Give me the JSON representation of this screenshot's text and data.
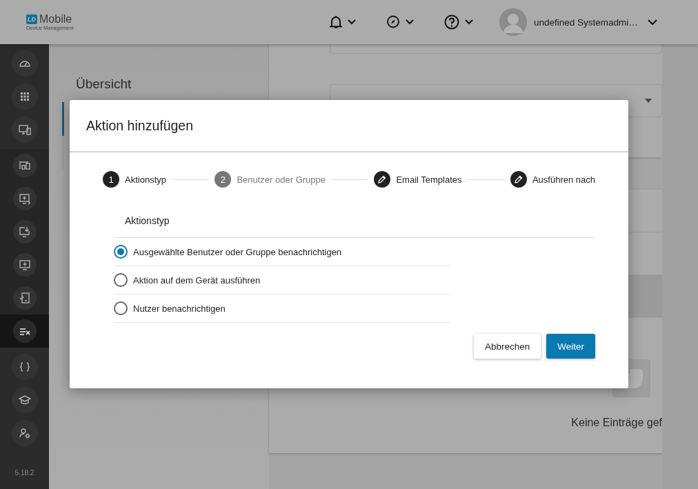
{
  "header": {
    "logo": {
      "mark": "LD",
      "title": "Mobile",
      "subtitle": "Device Management"
    },
    "user_name": "undefined Systemadmi…"
  },
  "sidebar": {
    "groups": [
      {
        "items": [
          {
            "selected": false
          },
          {
            "selected": false
          },
          {
            "selected": false
          }
        ]
      },
      {
        "items": [
          {
            "selected": false
          },
          {
            "selected": false
          },
          {
            "selected": false
          },
          {
            "selected": false
          },
          {
            "selected": false
          },
          {
            "selected": true
          }
        ]
      },
      {
        "items": [
          {
            "selected": false
          },
          {
            "selected": false
          },
          {
            "selected": false
          }
        ]
      }
    ],
    "version": "5.18.2"
  },
  "page": {
    "title": "Übersicht",
    "empty_text": "Keine Einträge gef"
  },
  "dialog": {
    "title": "Aktion hinzufügen",
    "steps": [
      {
        "kind": "number",
        "number": "1",
        "label": "Aktionstyp",
        "disabled": false
      },
      {
        "kind": "number",
        "number": "2",
        "label": "Benutzer oder Gruppe",
        "disabled": true
      },
      {
        "kind": "edit",
        "label": "Email Templates",
        "disabled": false
      },
      {
        "kind": "edit",
        "label": "Ausführen nach",
        "disabled": false
      }
    ],
    "section_title": "Aktionstyp",
    "options": [
      {
        "label": "Ausgewählte Benutzer oder Gruppe benachrichtigen",
        "selected": true
      },
      {
        "label": "Aktion auf dem Gerät ausführen",
        "selected": false
      },
      {
        "label": "Nutzer benachrichtigen",
        "selected": false
      }
    ],
    "buttons": [
      {
        "label": "Abbrechen",
        "kind": "secondary"
      },
      {
        "label": "Weiter",
        "kind": "primary"
      }
    ]
  }
}
